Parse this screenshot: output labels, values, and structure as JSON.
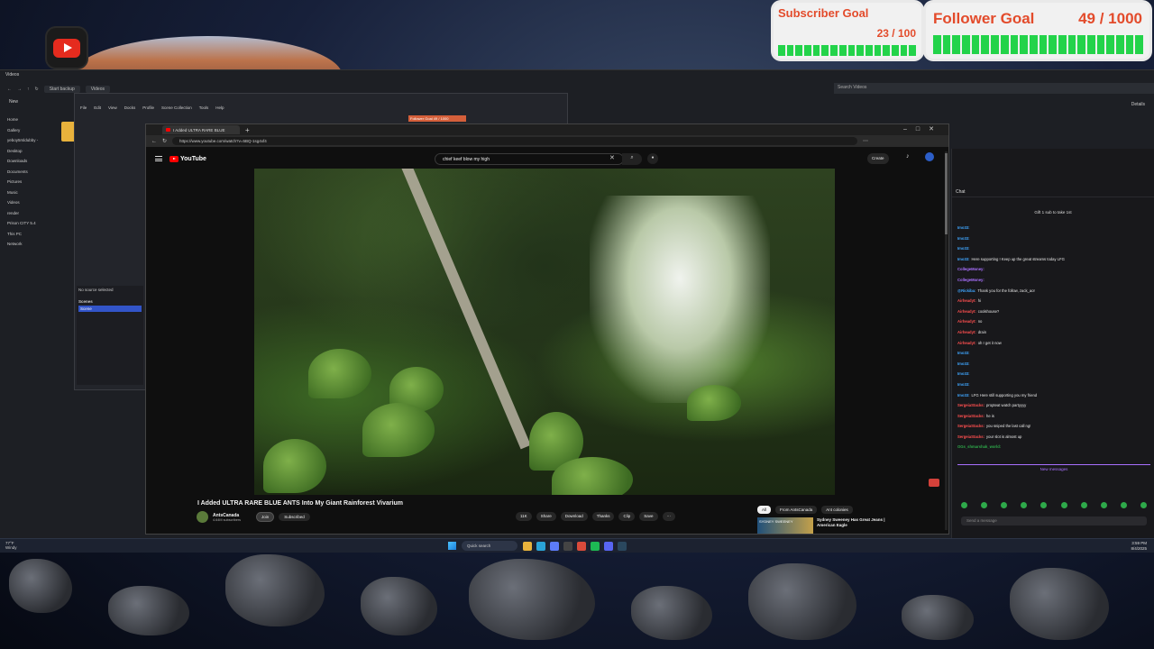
{
  "overlay": {
    "subscriber_goal": {
      "title": "Subscriber Goal",
      "count": "23 / 100",
      "progress": 0.23
    },
    "follower_goal": {
      "title": "Follower Goal",
      "count": "49 / 1000",
      "progress": 0.049
    },
    "colors": {
      "goal_text": "#e34b2b",
      "goal_bar": "#23d34a",
      "youtube_red": "#ff0000"
    }
  },
  "explorer": {
    "title": "Videos",
    "breadcrumb": [
      "Start backup",
      "Videos"
    ],
    "search_placeholder": "Search Videos",
    "details_label": "Details",
    "new_label": "New",
    "sidebar": [
      "Home",
      "Gallery",
      "yeboy5rsldubby -",
      "Desktop",
      "Downloads",
      "Documents",
      "Pictures",
      "Music",
      "Videos",
      "render",
      "Prison CITY 5.4",
      "This PC",
      "Network"
    ]
  },
  "obs": {
    "menu": [
      "File",
      "Edit",
      "View",
      "Docks",
      "Profile",
      "Scene Collection",
      "Tools",
      "Help"
    ],
    "no_source": "No source selected",
    "scenes_header": "Scenes",
    "scene_selected": "Scene",
    "mini_goal": "Follower Goal  49 / 1000"
  },
  "browser": {
    "tab_title": "I Added ULTRA RARE BLUE",
    "url": "https://www.youtube.com/watch?v=5BQ-1sg4xf4"
  },
  "youtube": {
    "logo_text": "YouTube",
    "search_query": "chief keef blow my high",
    "create_label": "Create",
    "video_title": "I Added ULTRA RARE BLUE ANTS Into My Giant Rainforest Vivarium",
    "channel_name": "AntsCanada",
    "channel_subs": "4.64M subscribers",
    "join_label": "Join",
    "subscribed_label": "Subscribed",
    "likes": "11K",
    "share_label": "Share",
    "download_label": "Download",
    "thanks_label": "Thanks",
    "clip_label": "Clip",
    "save_label": "Save",
    "chips": [
      "All",
      "From AntsCanada",
      "Ant colonies"
    ],
    "related": {
      "thumb_text": "SYDNEY SWEENEY",
      "title": "Sydney Sweeney Has Great Jeans | American Eagle"
    }
  },
  "chat": {
    "header": "Chat",
    "gift_notice": "Gift 1 sub to take 1st",
    "messages": [
      {
        "name": "Imo33:",
        "text": "",
        "color": "#3fa6ff"
      },
      {
        "name": "Imo33:",
        "text": "",
        "color": "#3fa6ff"
      },
      {
        "name": "Imo33:",
        "text": "",
        "color": "#3fa6ff"
      },
      {
        "name": "Imo33:",
        "text": "Here supporting !  Keep up the great streams today  LFG",
        "color": "#3fa6ff"
      },
      {
        "name": "CollegeMoney:",
        "text": "",
        "color": "#a970ff"
      },
      {
        "name": "CollegeMoney:",
        "text": "",
        "color": "#a970ff"
      },
      {
        "name": "@Rickiba:",
        "text": "Thank you for the follow, zack_ao!",
        "color": "#3fa6ff"
      },
      {
        "name": "Airheadyt:",
        "text": "hi",
        "color": "#ff4f4f"
      },
      {
        "name": "Airheadyt:",
        "text": "coolshouse?",
        "color": "#ff4f4f"
      },
      {
        "name": "Airheadyt:",
        "text": "no",
        "color": "#ff4f4f"
      },
      {
        "name": "Airheadyt:",
        "text": "drain",
        "color": "#ff4f4f"
      },
      {
        "name": "Airheadyt:",
        "text": "oh I get it now",
        "color": "#ff4f4f"
      },
      {
        "name": "Imo33:",
        "text": "",
        "color": "#3fa6ff"
      },
      {
        "name": "Imo33:",
        "text": "",
        "color": "#3fa6ff"
      },
      {
        "name": "Imo33:",
        "text": "",
        "color": "#3fa6ff"
      },
      {
        "name": "Imo33:",
        "text": "",
        "color": "#3fa6ff"
      },
      {
        "name": "Imo33:",
        "text": "LFG  Here still supporting you my friend",
        "color": "#3fa6ff"
      },
      {
        "name": "SergeiaStacks:",
        "text": "propteat watch partyyyy",
        "color": "#ff4f4f"
      },
      {
        "name": "SergeiaStacks:",
        "text": "he is",
        "color": "#ff4f4f"
      },
      {
        "name": "SergeiaStacks:",
        "text": "you sniped the last call ng!",
        "color": "#ff4f4f"
      },
      {
        "name": "SergeiaStacks:",
        "text": "your slot is almost up",
        "color": "#ff4f4f"
      },
      {
        "name": "OGs_shmarshak_world:",
        "text": "",
        "color": "#2ea94a"
      }
    ],
    "new_messages_label": "New messages",
    "input_placeholder": "Send a message"
  },
  "taskbar": {
    "weather_temp": "77°F",
    "weather_desc": "Windy",
    "search_placeholder": "Quick search",
    "time": "3:59 PM",
    "date": "8/4/2025"
  }
}
